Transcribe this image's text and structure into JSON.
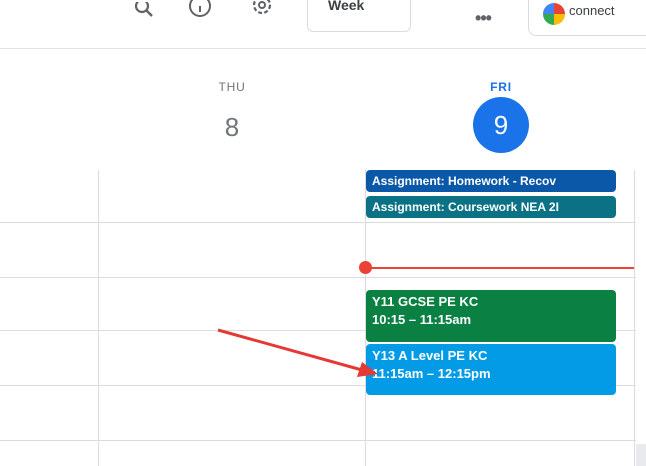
{
  "toolbar": {
    "icons": [
      "search-icon",
      "help-icon",
      "settings-icon"
    ],
    "view": "Week",
    "more": "•••",
    "connect_label": "connect"
  },
  "days": [
    {
      "label": "THU",
      "number": "8",
      "today": false
    },
    {
      "label": "FRI",
      "number": "9",
      "today": true
    }
  ],
  "all_day_events": [
    {
      "title": "Assignment: Homework - Recov",
      "color": "#0b57a8"
    },
    {
      "title": "Assignment: Coursework NEA 2I",
      "color": "#0b7285"
    }
  ],
  "events": [
    {
      "title": "Y11 GCSE PE KC",
      "time": "10:15 – 11:15am",
      "color": "#0b8043"
    },
    {
      "title": "Y13 A Level PE KC",
      "time": "11:15am – 12:15pm",
      "color": "#039be5"
    }
  ],
  "colors": {
    "today": "#1a73e8",
    "now_indicator": "#ea4335",
    "annotation_arrow": "#e53935"
  }
}
